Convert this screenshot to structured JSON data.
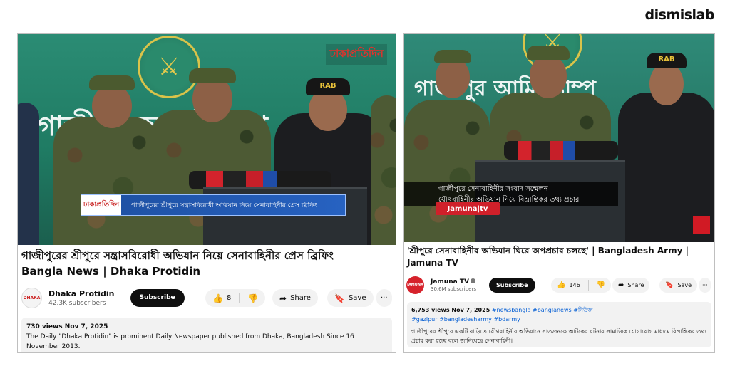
{
  "brand": "dismislab",
  "left": {
    "overlay_logo": "ঢাকাপ্রতিদিন",
    "lower_third_logo": "ঢাকাপ্রতিদিন",
    "lower_third_text": "গাজীপুরের শ্রীপুরে সন্ত্রাসবিরোধী অভিযান নিয়ে সেনাবাহিনীর প্রেস ব্রিফিং",
    "backdrop_text": "গাজীপুর আর্মি ক্যাম্প",
    "cap_label": "RAB",
    "title_line1": "গাজীপুরের শ্রীপুরে সন্ত্রাসবিরোধী অভিযান নিয়ে সেনাবাহিনীর প্রেস ব্রিফিং",
    "title_line2": "Bangla News | Dhaka Protidin",
    "channel_name": "Dhaka Protidin",
    "channel_subs": "42.3K subscribers",
    "subscribe": "Subscribe",
    "likes": "8",
    "share": "Share",
    "save": "Save",
    "more": "···",
    "meta": "730 views  Nov 7, 2025",
    "description": "The Daily \"Dhaka Protidin\" is prominent Daily Newspaper published from Dhaka, Bangladesh Since 16 November 2013."
  },
  "right": {
    "backdrop_text": "গাজীপুর আর্মি ক্যাম্প",
    "cap_label": "RAB",
    "caption_line1": "গাজীপুরে সেনাবাহিনীর সংবাদ সম্মেলন",
    "caption_line2": "যৌথবাহিনীর অভিযান নিয়ে বিভ্রান্তিকর তথ্য প্রচার",
    "channel_logo_text": "Jamuna|tv",
    "title": "'শ্রীপুরে সেনাবাহিনীর অভিযান ঘিরে অপপ্রচার চলছে' | Bangladesh Army | Jamuna TV",
    "channel_name": "Jamuna TV",
    "channel_subs": "30.6M subscribers",
    "subscribe": "Subscribe",
    "likes": "146",
    "share": "Share",
    "save": "Save",
    "more": "···",
    "meta": "6,753 views  Nov 7, 2025",
    "meta_tags": "#newsbangla #banglanews #নিউজ",
    "tags_line2": "#gazipur #bangladesharmy #bdarmy",
    "description": "গাজীপুরের শ্রীপুরে একটি বাড়িতে যৌথবাহিনীর অভিযানে সাতজনকে আটকের ঘটনায় সামাজিক যোগাযোগ মাধ্যমে বিভ্রান্তিকর তথ্য প্রচার করা হচ্ছে বলে জানিয়েছে সেনাবাহিনী।"
  },
  "colors": {
    "backdrop": "#2b8c74",
    "subscribe_bg": "#0f0f0f",
    "link": "#065fd4",
    "jamuna_red": "#d0202a",
    "lower_third_blue": "#1d4fa0"
  },
  "icons": [
    "thumbs-up-icon",
    "thumbs-down-icon",
    "share-icon",
    "save-icon",
    "more-icon",
    "verified-icon"
  ]
}
